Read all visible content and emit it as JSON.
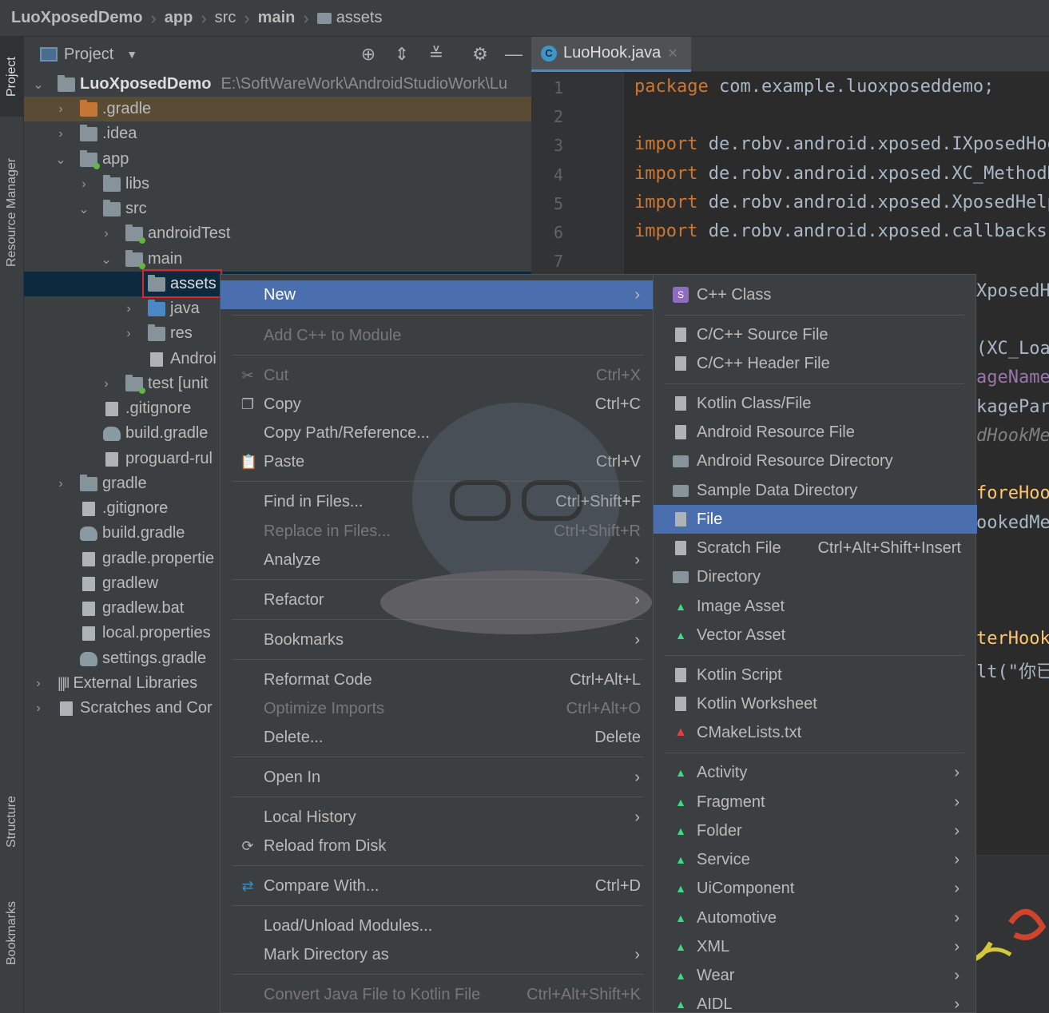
{
  "breadcrumb": [
    "LuoXposedDemo",
    "app",
    "src",
    "main",
    "assets"
  ],
  "left_stripe": {
    "project": "Project",
    "resource_manager": "Resource Manager",
    "structure": "Structure",
    "bookmarks": "Bookmarks"
  },
  "project_panel": {
    "title": "Project",
    "tree": [
      {
        "label": "LuoXposedDemo",
        "path": "E:\\SoftWareWork\\AndroidStudioWork\\Lu"
      },
      {
        "label": ".gradle"
      },
      {
        "label": ".idea"
      },
      {
        "label": "app"
      },
      {
        "label": "libs"
      },
      {
        "label": "src"
      },
      {
        "label": "androidTest"
      },
      {
        "label": "main"
      },
      {
        "label": "assets"
      },
      {
        "label": "java"
      },
      {
        "label": "res"
      },
      {
        "label": "Androi"
      },
      {
        "label": "test [unit"
      },
      {
        "label": ".gitignore"
      },
      {
        "label": "build.gradle"
      },
      {
        "label": "proguard-rul"
      },
      {
        "label": "gradle"
      },
      {
        "label": ".gitignore"
      },
      {
        "label": "build.gradle"
      },
      {
        "label": "gradle.propertie"
      },
      {
        "label": "gradlew"
      },
      {
        "label": "gradlew.bat"
      },
      {
        "label": "local.properties"
      },
      {
        "label": "settings.gradle"
      },
      {
        "label": "External Libraries"
      },
      {
        "label": "Scratches and Cor"
      }
    ]
  },
  "editor": {
    "tab": "LuoHook.java",
    "line_numbers": [
      "1",
      "2",
      "3",
      "4",
      "5",
      "6",
      "7"
    ],
    "lines": [
      {
        "kw": "package",
        "rest": " com.example.luoxposeddemo;"
      },
      {
        "kw": "",
        "rest": ""
      },
      {
        "kw": "import",
        "rest": " de.robv.android.xposed.IXposedHoo"
      },
      {
        "kw": "import",
        "rest": " de.robv.android.xposed.XC_MethodH"
      },
      {
        "kw": "import",
        "rest": " de.robv.android.xposed.XposedHelp"
      },
      {
        "kw": "import",
        "rest": " de.robv.android.xposed.callbacks."
      },
      {
        "kw": "",
        "rest": ""
      }
    ],
    "right_fragments": [
      "XposedH",
      "(XC_Loa",
      "ageName",
      "kagePar",
      "dHookMe",
      "foreHoo",
      "ookedMe",
      "terHook",
      "lt(\"你已"
    ]
  },
  "context_menu": {
    "items": [
      {
        "label": "New",
        "submenu": true,
        "selected": true
      },
      {
        "label": "Add C++ to Module",
        "disabled": true
      },
      {
        "label": "Cut",
        "shortcut": "Ctrl+X",
        "disabled": true
      },
      {
        "label": "Copy",
        "shortcut": "Ctrl+C"
      },
      {
        "label": "Copy Path/Reference..."
      },
      {
        "label": "Paste",
        "shortcut": "Ctrl+V"
      },
      {
        "label": "Find in Files...",
        "shortcut": "Ctrl+Shift+F"
      },
      {
        "label": "Replace in Files...",
        "shortcut": "Ctrl+Shift+R",
        "disabled": true
      },
      {
        "label": "Analyze",
        "submenu": true
      },
      {
        "label": "Refactor",
        "submenu": true
      },
      {
        "label": "Bookmarks",
        "submenu": true
      },
      {
        "label": "Reformat Code",
        "shortcut": "Ctrl+Alt+L"
      },
      {
        "label": "Optimize Imports",
        "shortcut": "Ctrl+Alt+O",
        "disabled": true
      },
      {
        "label": "Delete...",
        "shortcut": "Delete"
      },
      {
        "label": "Open In",
        "submenu": true
      },
      {
        "label": "Local History",
        "submenu": true
      },
      {
        "label": "Reload from Disk"
      },
      {
        "label": "Compare With...",
        "shortcut": "Ctrl+D"
      },
      {
        "label": "Load/Unload Modules..."
      },
      {
        "label": "Mark Directory as",
        "submenu": true
      },
      {
        "label": "Convert Java File to Kotlin File",
        "shortcut": "Ctrl+Alt+Shift+K",
        "disabled": true
      }
    ]
  },
  "new_submenu": {
    "items": [
      {
        "label": "C++ Class"
      },
      {
        "label": "C/C++ Source File"
      },
      {
        "label": "C/C++ Header File"
      },
      {
        "label": "Kotlin Class/File"
      },
      {
        "label": "Android Resource File"
      },
      {
        "label": "Android Resource Directory"
      },
      {
        "label": "Sample Data Directory"
      },
      {
        "label": "File",
        "selected": true
      },
      {
        "label": "Scratch File",
        "shortcut": "Ctrl+Alt+Shift+Insert"
      },
      {
        "label": "Directory"
      },
      {
        "label": "Image Asset"
      },
      {
        "label": "Vector Asset"
      },
      {
        "label": "Kotlin Script"
      },
      {
        "label": "Kotlin Worksheet"
      },
      {
        "label": "CMakeLists.txt"
      },
      {
        "label": "Activity",
        "submenu": true
      },
      {
        "label": "Fragment",
        "submenu": true
      },
      {
        "label": "Folder",
        "submenu": true
      },
      {
        "label": "Service",
        "submenu": true
      },
      {
        "label": "UiComponent",
        "submenu": true
      },
      {
        "label": "Automotive",
        "submenu": true
      },
      {
        "label": "XML",
        "submenu": true
      },
      {
        "label": "Wear",
        "submenu": true
      },
      {
        "label": "AIDL",
        "submenu": true
      }
    ]
  },
  "colors": {
    "selection": "#4b6eaf",
    "keyword": "#cc7832",
    "highlight_box": "#e0242b"
  }
}
